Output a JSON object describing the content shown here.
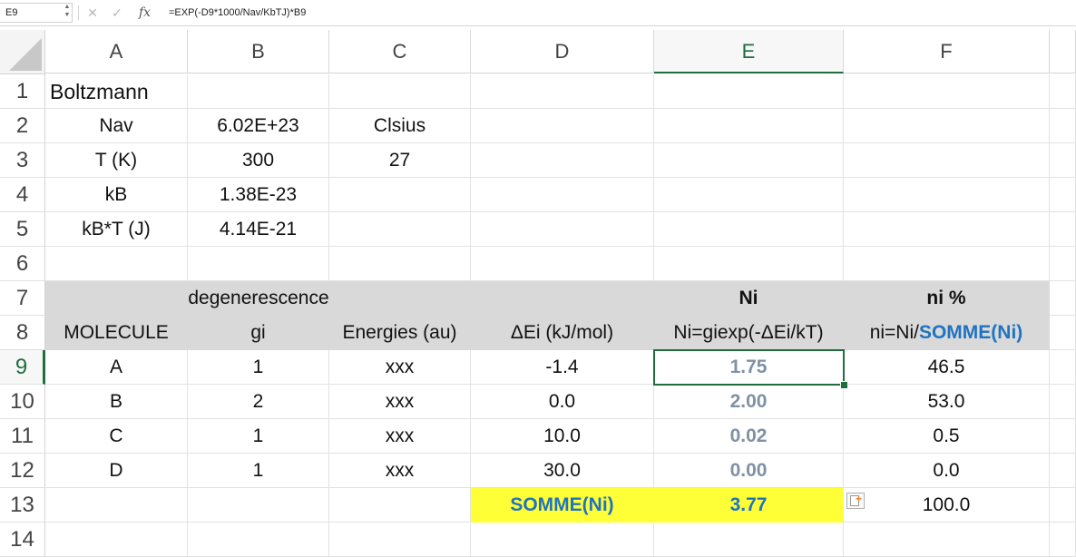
{
  "formula_bar": {
    "name_box": "E9",
    "cancel_icon": "✕",
    "enter_icon": "✓",
    "fx_label": "fx",
    "formula": "=EXP(-D9*1000/Nav/KbTJ)*B9"
  },
  "columns": [
    "A",
    "B",
    "C",
    "D",
    "E",
    "F"
  ],
  "rows": [
    "1",
    "2",
    "3",
    "4",
    "5",
    "6",
    "7",
    "8",
    "9",
    "10",
    "11",
    "12",
    "13",
    "14"
  ],
  "selected_cell": "E9",
  "cells": {
    "A1": "Boltzmann",
    "A2": "Nav",
    "B2": "6.02E+23",
    "C2": "Clsius",
    "A3": "T (K)",
    "B3": "300",
    "C3": "27",
    "A4": "kB",
    "B4": "1.38E-23",
    "A5": "kB*T (J)",
    "B5": "4.14E-21",
    "B7": "degenerescence",
    "E7": "Ni",
    "F7": "ni %",
    "A8": "MOLECULE",
    "B8": "gi",
    "C8": "Energies (au)",
    "D8": "ΔEi (kJ/mol)",
    "E8": "Ni=giexp(-ΔEi/kT)",
    "F8_a": "ni=Ni/",
    "F8_b": "SOMME(Ni)",
    "A9": "A",
    "B9": "1",
    "C9": "xxx",
    "D9": "-1.4",
    "E9": "1.75",
    "F9": "46.5",
    "A10": "B",
    "B10": "2",
    "C10": "xxx",
    "D10": "0.0",
    "E10": "2.00",
    "F10": "53.0",
    "A11": "C",
    "B11": "1",
    "C11": "xxx",
    "D11": "10.0",
    "E11": "0.02",
    "F11": "0.5",
    "A12": "D",
    "B12": "1",
    "C12": "xxx",
    "D12": "30.0",
    "E12": "0.00",
    "F12": "0.0",
    "D13": "SOMME(Ni)",
    "E13": "3.77",
    "F13": "100.0"
  },
  "colors": {
    "header_fill": "#d9d9d9",
    "sum_fill": "#ffff38",
    "blue_text": "#1f73c0",
    "computed_text": "#7f91a5",
    "selection": "#1e6e3e"
  },
  "icons": {
    "corner": "select-all-triangle",
    "paste_options": "paste-options-icon"
  }
}
